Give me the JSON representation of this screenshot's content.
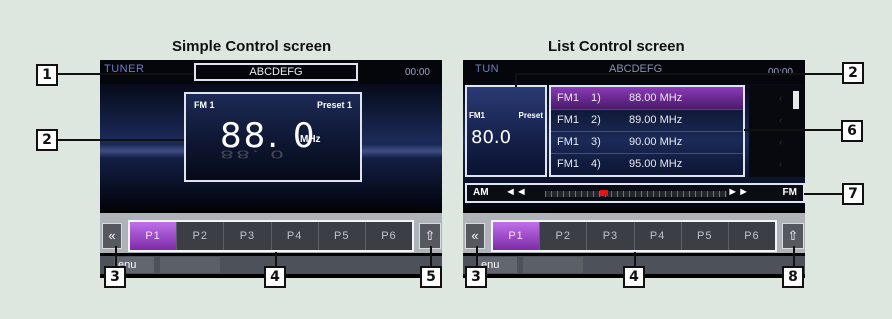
{
  "titles": {
    "simple": "Simple Control screen",
    "list": "List Control screen"
  },
  "callouts": {
    "c1": "1",
    "c2": "2",
    "c3": "3",
    "c4": "4",
    "c5": "5",
    "c6": "6",
    "c7": "7",
    "c8": "8"
  },
  "simple": {
    "tuner_logo": "TUNER",
    "station_name": "ABCDEFG",
    "clock": "00:00",
    "band": "FM 1",
    "preset": "Preset 1",
    "frequency": "88. 0",
    "unit": "MHz",
    "presets": [
      "P1",
      "P2",
      "P3",
      "P4",
      "P5",
      "P6"
    ],
    "active_preset_index": 0,
    "menu_label": "enu",
    "prev_icon": "«",
    "upload_icon": "⇧"
  },
  "list": {
    "tuner_logo": "TUN",
    "station_name": "ABCDEFG",
    "clock": "00:00",
    "band": "FM1",
    "preset": "Preset",
    "frequency": "80.0",
    "items": [
      {
        "band": "FM1",
        "num": "1)",
        "freq": "88.00 MHz"
      },
      {
        "band": "FM1",
        "num": "2)",
        "freq": "89.00 MHz"
      },
      {
        "band": "FM1",
        "num": "3)",
        "freq": "90.00 MHz"
      },
      {
        "band": "FM1",
        "num": "4)",
        "freq": "95.00 MHz"
      }
    ],
    "selected_index": 0,
    "tune_am": "AM",
    "tune_fm": "FM",
    "seek_back": "◄◄",
    "seek_fwd": "►►",
    "tuning_position": 0.3,
    "presets": [
      "P1",
      "P2",
      "P3",
      "P4",
      "P5",
      "P6"
    ],
    "active_preset_index": 0,
    "menu_label": "enu",
    "prev_icon": "«",
    "upload_icon": "⇧"
  },
  "colors": {
    "accent_purple": "#9b48c9",
    "tune_marker": "#e21414",
    "page_bg": "#dde7e0"
  }
}
